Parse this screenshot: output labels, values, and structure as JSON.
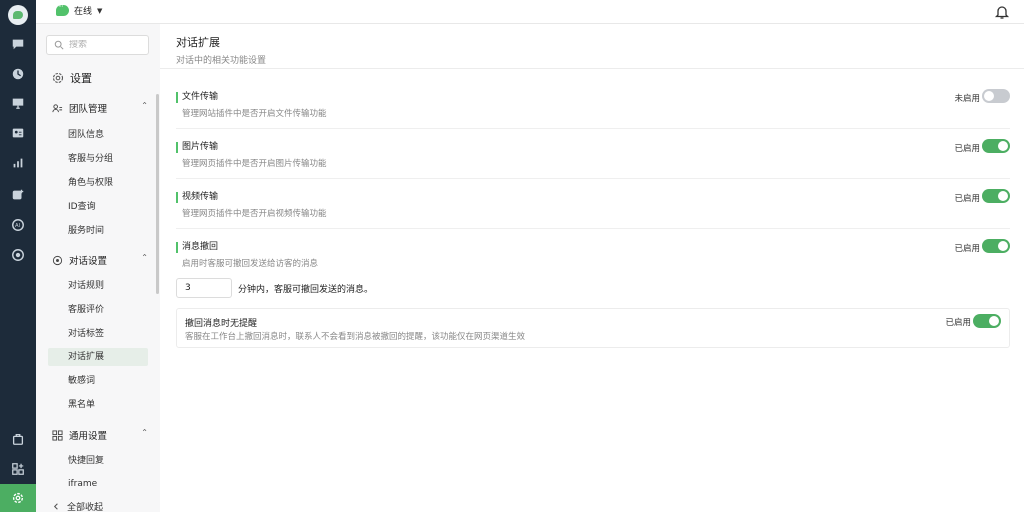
{
  "topbar": {
    "status_label": "在线"
  },
  "sidebar": {
    "search_placeholder": "搜索",
    "settings_title": "设置",
    "groups": [
      {
        "label": "团队管理",
        "items": [
          "团队信息",
          "客服与分组",
          "角色与权限",
          "ID查询",
          "服务时间"
        ]
      },
      {
        "label": "对话设置",
        "items": [
          "对话规则",
          "客服评价",
          "对话标签",
          "对话扩展",
          "敏感词",
          "黑名单"
        ]
      },
      {
        "label": "通用设置",
        "items": [
          "快捷回复",
          "iframe"
        ]
      }
    ],
    "active_item": "对话扩展",
    "collapse_all": "全部收起"
  },
  "main": {
    "title": "对话扩展",
    "subtitle": "对话中的相关功能设置",
    "settings": [
      {
        "title": "文件传输",
        "desc": "管理网站插件中是否开启文件传输功能",
        "state": "未启用",
        "enabled": false
      },
      {
        "title": "图片传输",
        "desc": "管理网页插件中是否开启图片传输功能",
        "state": "已启用",
        "enabled": true
      },
      {
        "title": "视频传输",
        "desc": "管理网页插件中是否开启视频传输功能",
        "state": "已启用",
        "enabled": true
      },
      {
        "title": "消息撤回",
        "desc": "启用时客服可撤回发送给访客的消息",
        "state": "已启用",
        "enabled": true
      }
    ],
    "recall": {
      "minutes_value": "3",
      "minutes_suffix": "分钟内，客服可撤回发送的消息。"
    },
    "silent_recall": {
      "title": "撤回消息时无提醒",
      "desc": "客服在工作台上撤回消息时，联系人不会看到消息被撤回的提醒，该功能仅在网页渠道生效",
      "state": "已启用",
      "enabled": true
    }
  },
  "colors": {
    "accent": "#4cae62",
    "rail_bg": "#1d2b3a",
    "toggle_off": "#c8cbd0"
  }
}
